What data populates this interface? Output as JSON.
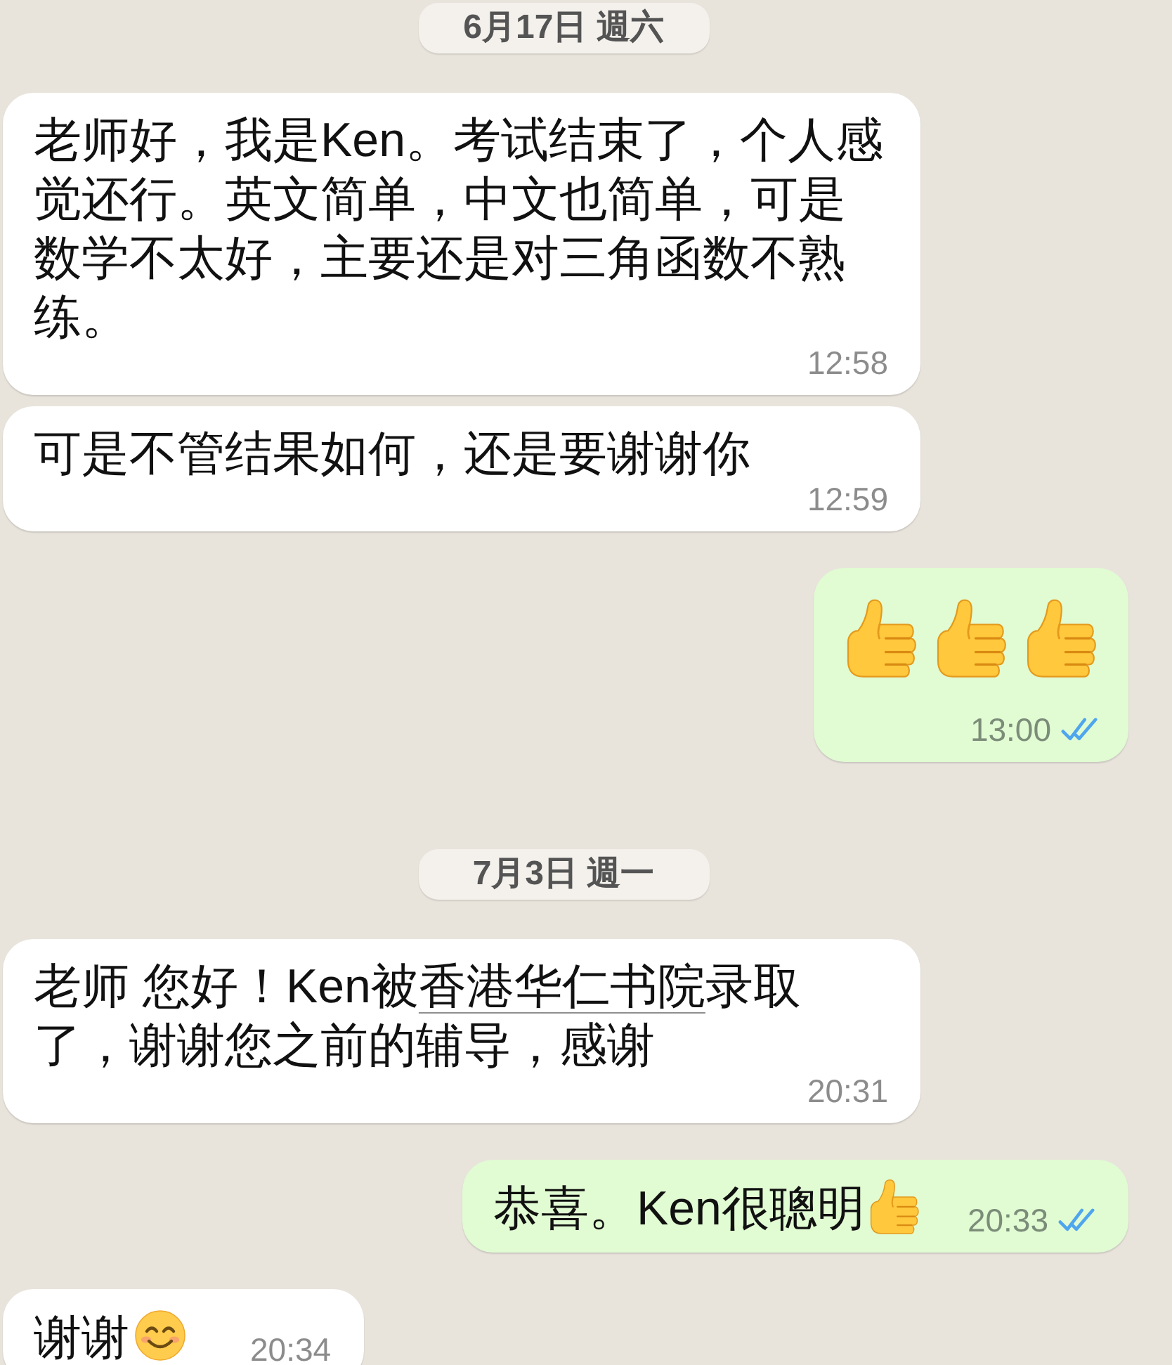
{
  "chat": {
    "items": [
      {
        "kind": "date",
        "text": "6月17日 週六"
      },
      {
        "kind": "text_message",
        "outgoing": false,
        "parts": [
          {
            "kind": "text",
            "text": "老师好，我是Ken。考试结束了，个人感觉还行。英文简单，中文也简单，可是数学不太好，主要还是对三角函数不熟练。"
          }
        ],
        "time": "12:58"
      },
      {
        "kind": "text_message",
        "outgoing": false,
        "parts": [
          {
            "kind": "text",
            "text": "可是不管结果如何，还是要谢谢你"
          }
        ],
        "time": "12:59"
      },
      {
        "kind": "emoji_message",
        "outgoing": true,
        "parts": [
          {
            "kind": "thumbs_up"
          },
          {
            "kind": "thumbs_up"
          },
          {
            "kind": "thumbs_up"
          }
        ],
        "time": "13:00",
        "read": true
      },
      {
        "kind": "date",
        "text": "7月3日 週一"
      },
      {
        "kind": "text_message",
        "outgoing": false,
        "parts": [
          {
            "kind": "text",
            "text": "老师 您好！Ken被"
          },
          {
            "kind": "link",
            "text": "香港华仁书院"
          },
          {
            "kind": "text",
            "text": "录取了，谢谢您之前的辅导，感谢"
          }
        ],
        "time": "20:31"
      },
      {
        "kind": "text_message",
        "outgoing": true,
        "parts": [
          {
            "kind": "text",
            "text": "恭喜。Ken很聰明"
          },
          {
            "kind": "thumbs_up"
          }
        ],
        "time": "20:33",
        "read": true
      },
      {
        "kind": "text_message",
        "outgoing": false,
        "parts": [
          {
            "kind": "text",
            "text": "谢谢"
          },
          {
            "kind": "smile"
          }
        ],
        "time": "20:34"
      }
    ]
  }
}
